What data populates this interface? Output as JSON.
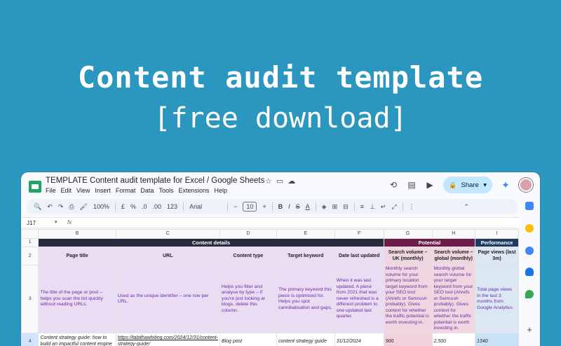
{
  "hero": {
    "title": "Content audit template",
    "subtitle": "[free download]"
  },
  "app": {
    "doc_title": "TEMPLATE Content audit template for Excel / Google Sheets",
    "menu": [
      "File",
      "Edit",
      "View",
      "Insert",
      "Format",
      "Data",
      "Tools",
      "Extensions",
      "Help"
    ],
    "share_label": "Share"
  },
  "toolbar": {
    "zoom": "100%",
    "currency": "£",
    "percent": "%",
    "dec_down": ".0",
    "dec_up": ".00",
    "number_format": "123",
    "font": "Arial",
    "font_size": "10",
    "bold": "B",
    "italic": "I",
    "strike": "S",
    "text_color": "A"
  },
  "formula_bar": {
    "cell_ref": "J17",
    "fx": "fx"
  },
  "sheet": {
    "columns": [
      "B",
      "C",
      "D",
      "E",
      "F",
      "G",
      "H",
      "I"
    ],
    "row_numbers": [
      "1",
      "2",
      "3",
      "4"
    ],
    "bands": {
      "content_details": "Content details",
      "potential": "Potential",
      "performance": "Performance"
    },
    "headers": [
      "Page title",
      "URL",
      "Content type",
      "Target keyword",
      "Date last updated",
      "Search volume – UK (monthly)",
      "Search volume – global (monthly)",
      "Page views (last 3m)"
    ],
    "descriptions": [
      "The title of the page or post – helps you scan the list quickly without reading URLs.",
      "Used as the unique identifier – one row per URL.",
      "Helps you filter and analyse by type – if you're just looking at blogs, delete this column.",
      "The primary keyword this piece is optimised for. Helps you spot cannibalisation and gaps.",
      "When it was last updated. A piece from 2021 that was never refreshed is a different problem to one updated last quarter.",
      "Monthly search volume for your primary location target keyword from your SEO tool (Ahrefs or Semrush probably). Gives context for whether the traffic potential is worth investing in.",
      "Monthly global search volume for your target keyword from your SEO tool (Ahrefs or Semrush probably). Gives context for whether the traffic potential is worth investing in.",
      "Total page views in the last 3 months from Google Analytics."
    ],
    "row4": [
      "Content strategy guide: how to build an impactful content engine",
      "https://tabithawhiting.com/2024/12/31/content-strategy-guide/",
      "Blog post",
      "content strategy guide",
      "31/12/2024",
      "900",
      "2,500",
      "1340"
    ]
  },
  "colors": {
    "background": "#2b97bf",
    "share_button": "#c2e7ff",
    "band_dark": "#262b3d",
    "band_plum": "#6b1d4a",
    "band_navy": "#1f3b5f",
    "details_fill": "#eadcf2",
    "potential_fill": "#f0d6e1",
    "performance_fill": "#dbe7f3"
  }
}
